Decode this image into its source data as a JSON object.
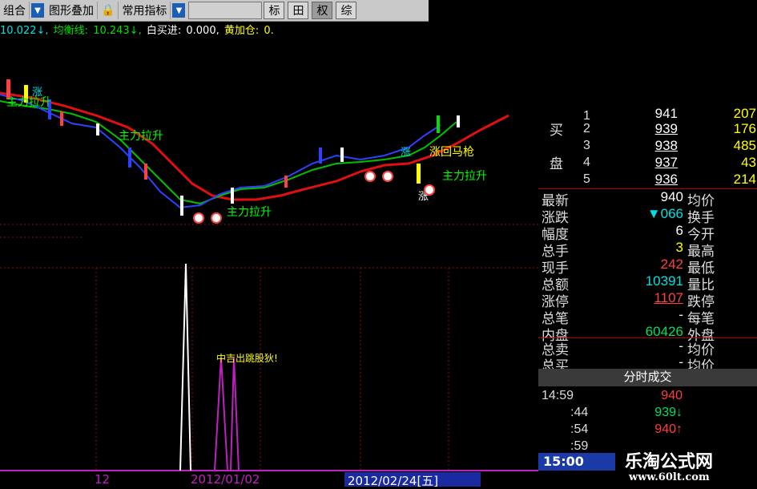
{
  "toolbar": {
    "combo_label": "组合",
    "overlay_label": "图形叠加",
    "indicator_label": "常用指标",
    "btn_biao": "标",
    "btn_grid": "田",
    "btn_quan": "权",
    "btn_more": "综"
  },
  "infoline": {
    "v1": "10.022↓,",
    "balance_label": "均衡线:",
    "balance_value": "10.243↓,",
    "buyin_label": "白买进:",
    "buyin_value": "0.000,",
    "add_label": "黄加仓:",
    "add_value": "0."
  },
  "chart_labels": {
    "zhu_li_la_sheng": "主力拉升",
    "zhang": "涨",
    "hui_ma_qiang": "涨回马枪",
    "upper_note": "主力拉升",
    "lower_note": "中吉出跳股狄!"
  },
  "order_book": {
    "side_buy_1": "买",
    "side_buy_2": "盘",
    "levels": [
      {
        "n": "1",
        "price": "941",
        "vol": "207"
      },
      {
        "n": "2",
        "price": "939",
        "vol": "176"
      },
      {
        "n": "3",
        "price": "938",
        "vol": "485"
      },
      {
        "n": "4",
        "price": "937",
        "vol": "43"
      },
      {
        "n": "5",
        "price": "936",
        "vol": "214"
      }
    ]
  },
  "quote": [
    {
      "label": "最新",
      "value": "940",
      "label2": "均价",
      "color": "#ffffff"
    },
    {
      "label": "涨跌",
      "value": "▼066",
      "label2": "换手",
      "color": "#00e0e0"
    },
    {
      "label": "幅度",
      "value": "6",
      "label2": "今开",
      "color": "#ffffff"
    },
    {
      "label": "总手",
      "value": "3",
      "label2": "最高",
      "color": "#ffff00"
    },
    {
      "label": "现手",
      "value": "242",
      "label2": "最低",
      "color": "#ff4040"
    },
    {
      "label": "总额",
      "value": "10391",
      "label2": "量比",
      "color": "#00e0e0"
    },
    {
      "label": "涨停",
      "value": "1107",
      "label2": "跌停",
      "color": "#ff4040"
    },
    {
      "label": "总笔",
      "value": "-",
      "label2": "每笔",
      "color": "#ffffff"
    },
    {
      "label": "内盘",
      "value": "60426",
      "label2": "外盘",
      "color": "#00e060"
    },
    {
      "label": "总卖",
      "value": "-",
      "label2": "均价",
      "color": "#ffffff"
    },
    {
      "label": "总买",
      "value": "-",
      "label2": "均价",
      "color": "#ffffff"
    }
  ],
  "ticks": {
    "header": "分时成交",
    "rows": [
      {
        "t": "14:59",
        "p": "940"
      },
      {
        "t": ":44",
        "p": "939↓"
      },
      {
        "t": ":54",
        "p": "940↑"
      },
      {
        "t": ":59",
        "p": ""
      }
    ],
    "clock": "15:00"
  },
  "dates": {
    "d1": "12",
    "d2": "2012/01/02",
    "d3": "2012/02/24[五]"
  },
  "brand": {
    "name": "乐淘公式网",
    "url": "www.60lt.com"
  },
  "colors": {
    "up": "#ff4040",
    "down": "#00e0e0",
    "ma_red": "#e01010",
    "ma_green": "#00c000",
    "ma_blue": "#3040ff",
    "indicator": "#c020c0"
  }
}
